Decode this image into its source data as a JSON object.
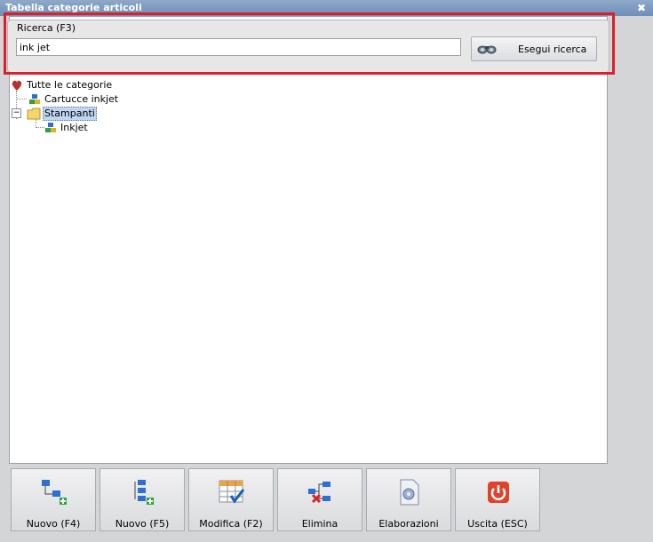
{
  "window": {
    "title": "Tabella categorie articoli",
    "close_glyph": "✖"
  },
  "search": {
    "legend": "Ricerca (F3)",
    "value": "ink jet",
    "button_label": "Esegui ricerca",
    "button_icon": "binoculars-icon"
  },
  "tree": {
    "root": {
      "label": "Tutte le categorie",
      "icon": "category-root-icon"
    },
    "items": [
      {
        "label": "Cartucce inkjet",
        "icon": "cubes-icon"
      },
      {
        "label": "Stampanti",
        "icon": "folder-icon",
        "expanded": true,
        "selected": true,
        "expander": "−"
      },
      {
        "label": "Inkjet",
        "icon": "cubes-icon"
      }
    ]
  },
  "toolbar": {
    "buttons": [
      {
        "label": "Nuovo (F4)",
        "icon": "new-sibling-icon"
      },
      {
        "label": "Nuovo (F5)",
        "icon": "new-child-icon"
      },
      {
        "label": "Modifica (F2)",
        "icon": "edit-grid-icon"
      },
      {
        "label": "Elimina",
        "icon": "delete-node-icon"
      },
      {
        "label": "Elaborazioni",
        "icon": "processing-icon"
      },
      {
        "label": "Uscita (ESC)",
        "icon": "exit-power-icon"
      }
    ]
  },
  "colors": {
    "highlight_border": "#e11d2a",
    "selection": "#bfd6f0",
    "title_bar": "#7795bd"
  }
}
